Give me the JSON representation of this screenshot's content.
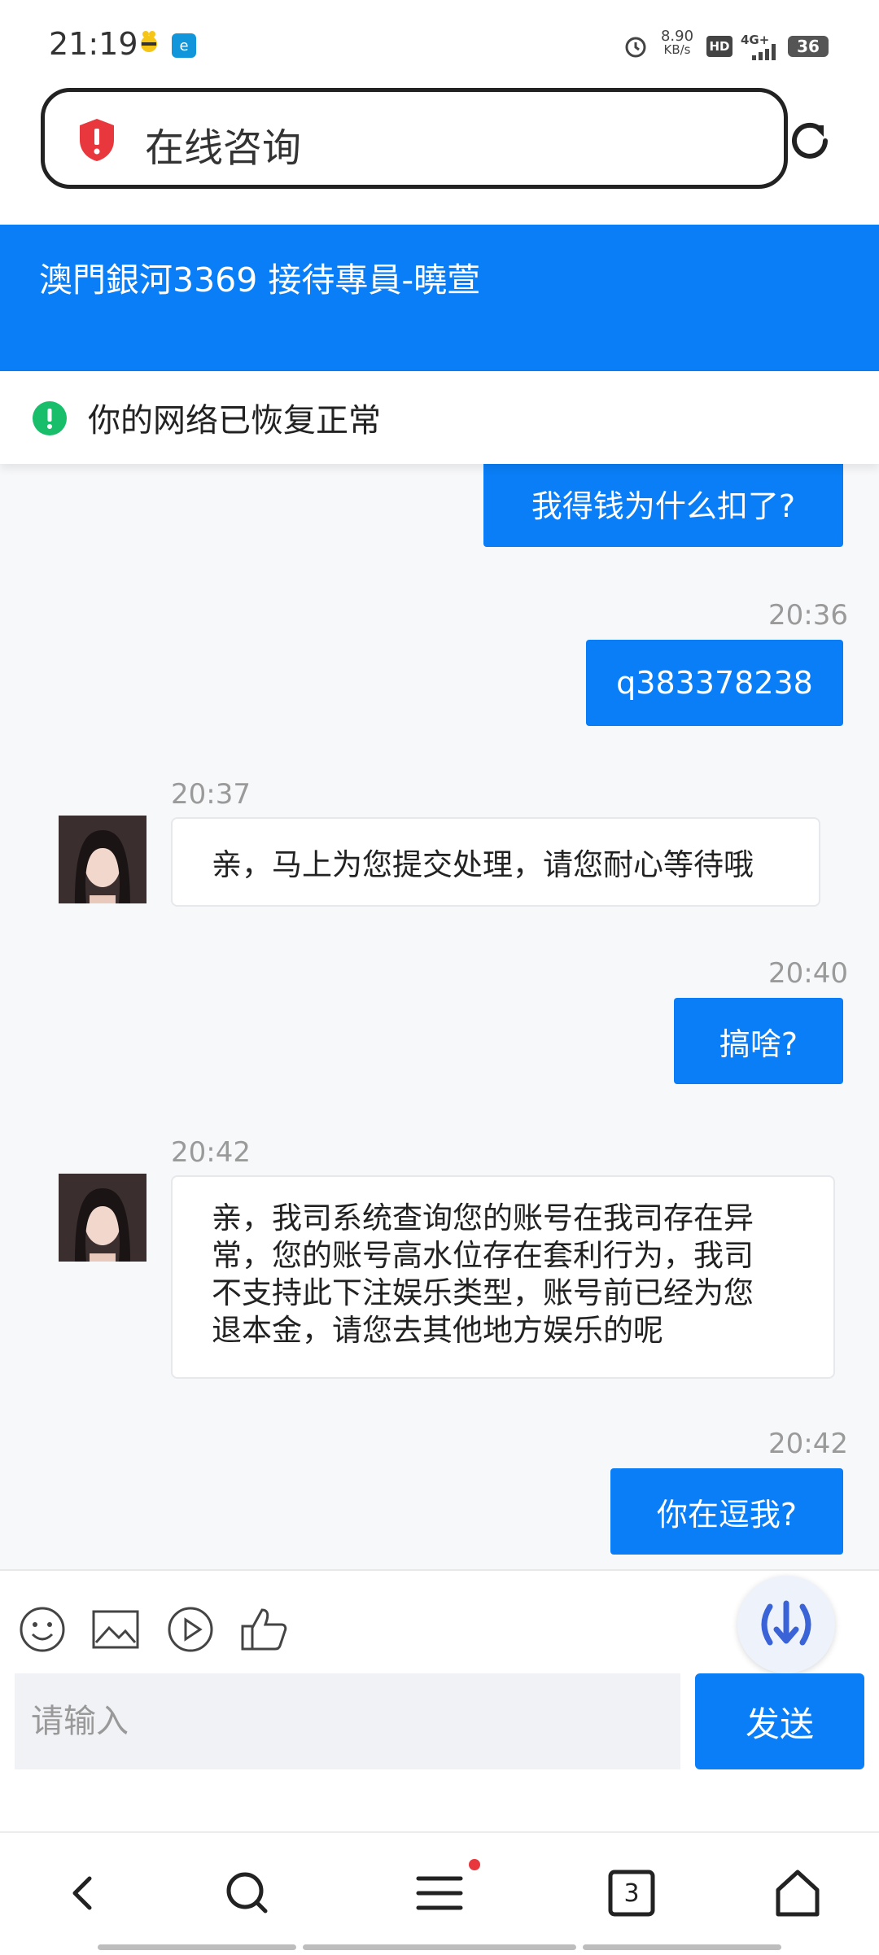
{
  "status_bar": {
    "time": "21:19",
    "net_speed_value": "8.90",
    "net_speed_unit": "KB/s",
    "hd_label": "HD",
    "network_label": "4G+",
    "battery": "36"
  },
  "browser": {
    "url_title": "在线咨询",
    "security_color": "#e8383d"
  },
  "chat_header": {
    "title": "澳門銀河3369 接待專員-曉萱",
    "color": "#0a7ef7"
  },
  "notice": {
    "text": "你的网络已恢复正常",
    "icon_color": "#19be6b"
  },
  "messages": [
    {
      "from": "user",
      "time": "",
      "text": "我得钱为什么扣了?"
    },
    {
      "from": "user",
      "time": "20:36",
      "text": "q383378238"
    },
    {
      "from": "agent",
      "time": "20:37",
      "text": "亲，马上为您提交处理，请您耐心等待哦"
    },
    {
      "from": "user",
      "time": "20:40",
      "text": "搞啥?"
    },
    {
      "from": "agent",
      "time": "20:42",
      "lines": [
        "亲，我司系统查询您的账号在我司存在异",
        "常，您的账号高水位存在套利行为，我司",
        "不支持此下注娱乐类型，账号前已经为您",
        "退本金，请您去其他地方娱乐的呢"
      ]
    },
    {
      "from": "user",
      "time": "20:42",
      "text": "你在逗我?"
    }
  ],
  "composer": {
    "tools": [
      "emoji-icon",
      "image-icon",
      "video-icon",
      "thumbs-up-icon"
    ],
    "placeholder": "请输入",
    "send_label": "发送"
  },
  "nav": {
    "tab_count": "3",
    "items": [
      "back-icon",
      "search-icon",
      "menu-icon",
      "tabs-icon",
      "home-icon"
    ]
  }
}
